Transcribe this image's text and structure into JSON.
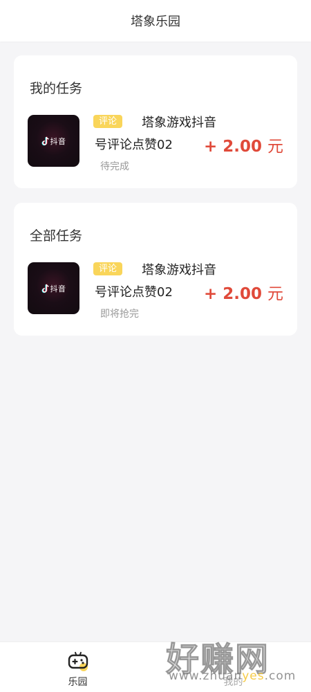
{
  "header": {
    "title": "塔象乐园"
  },
  "my_tasks": {
    "section_title": "我的任务",
    "task": {
      "tag": "评论",
      "title_line1": "塔象游戏抖音",
      "title_line2": "号评论点赞02",
      "reward": "+ 2.00",
      "reward_unit": "元",
      "status": "待完成",
      "thumb_logo_text": "抖音"
    }
  },
  "all_tasks": {
    "section_title": "全部任务",
    "task": {
      "tag": "评论",
      "title_line1": "塔象游戏抖音",
      "title_line2": "号评论点赞02",
      "reward": "+ 2.00",
      "reward_unit": "元",
      "status": "即将抢完",
      "thumb_logo_text": "抖音"
    }
  },
  "tabbar": {
    "items": [
      {
        "label": "乐园",
        "icon": "gamepad-icon",
        "active": true
      },
      {
        "label": "我的",
        "icon": "user-icon",
        "active": false
      }
    ]
  },
  "watermark": {
    "big": "好赚网",
    "small_prefix": "www.zhuan",
    "small_accent": "yes",
    "small_suffix": ".com"
  },
  "colors": {
    "accent_tag": "#f9d55a",
    "reward": "#e04a3a",
    "background": "#f5f5f7"
  }
}
